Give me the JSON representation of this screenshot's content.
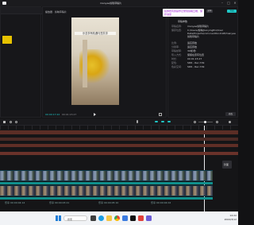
{
  "app": {
    "title": "manyee剪辑草稿片",
    "window_controls": [
      "–",
      "□",
      "✕"
    ]
  },
  "player": {
    "title": "播放器 · 剪映草稿片",
    "video_caption": "乐意享有机遇与您共享",
    "time_current": "00:00:17:22",
    "time_total": "00:01:15:27",
    "play_icon": "play-icon"
  },
  "top_right": {
    "tooltip": "将你所有的操作记录到剪映云端，保存进度",
    "export_label": "导出",
    "share_label": "分享"
  },
  "draft_panel": {
    "title": "草稿参数",
    "rows": [
      {
        "label": "草稿名称:",
        "value": "manyee剪辑草稿片"
      },
      {
        "label": "保存位置:",
        "value": "C:/Users/剪映/JianyingPro/User Data/Projects/com.lveditor.draft/manyee剪辑草稿片"
      },
      {
        "label": "比例:",
        "value": "适应原始"
      },
      {
        "label": "分辨率:",
        "value": "适应原始"
      },
      {
        "label": "草稿帧率:",
        "value": "30帧/秒"
      },
      {
        "label": "导入方式:",
        "value": "保留在原有位置"
      },
      {
        "label": "时长:",
        "value": "00:01:15:27"
      },
      {
        "label": "配色:",
        "value": "SDR - Rec.709"
      },
      {
        "label": "色彩空间:",
        "value": "SDR - Rec.709"
      }
    ],
    "modify_button": "修改"
  },
  "timeline": {
    "track_labels": [
      "封面"
    ],
    "clip_labels": [
      "乐享 00:00:04:14",
      "乐享 00:00:03:21",
      "乐享 00:00:05:10",
      "乐享 00:00:04:02"
    ]
  },
  "taskbar": {
    "search": "搜索",
    "time": "14:22",
    "date": "2024/3/12"
  }
}
